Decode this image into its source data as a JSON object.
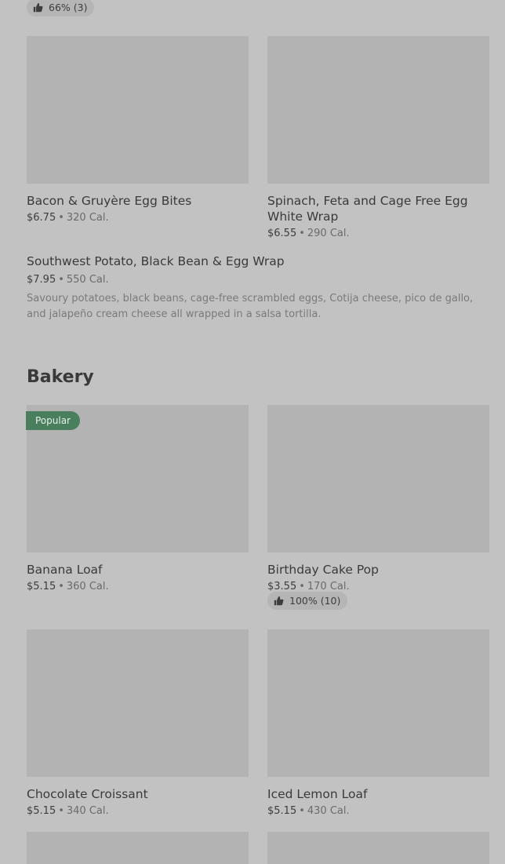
{
  "top_rating": {
    "text": "66% (3)",
    "icon": "thumbs-up-icon"
  },
  "breakfast": {
    "items": [
      {
        "name": "Bacon & Gruyère Egg Bites",
        "price": "$6.75",
        "separator": "•",
        "calories": "320 Cal."
      },
      {
        "name": "Spinach, Feta and Cage Free Egg",
        "name_line2": "White Wrap",
        "price": "$6.55",
        "separator": "•",
        "calories": "290 Cal."
      }
    ],
    "list_item": {
      "name": "Southwest Potato, Black Bean & Egg Wrap",
      "price": "$7.95",
      "separator": "•",
      "calories": "550 Cal.",
      "description": "Savoury potatoes, black beans, cage-free scrambled eggs, Cotija cheese, pico de gallo, and jalapeño cream cheese all wrapped in a salsa tortilla."
    }
  },
  "bakery": {
    "title": "Bakery",
    "popular_badge": "Popular",
    "items": [
      {
        "name": "Banana Loaf",
        "price": "$5.15",
        "separator": "•",
        "calories": "360 Cal."
      },
      {
        "name": "Birthday Cake Pop",
        "price": "$3.55",
        "separator": "•",
        "calories": "170 Cal.",
        "rating": "100% (10)"
      },
      {
        "name": "Chocolate Croissant",
        "price": "$5.15",
        "separator": "•",
        "calories": "340 Cal."
      },
      {
        "name": "Iced Lemon Loaf",
        "price": "$5.15",
        "separator": "•",
        "calories": "430 Cal."
      }
    ]
  },
  "colors": {
    "background": "#c2c2c2",
    "image_placeholder": "#b3b3b3",
    "popular_badge": "#4a7f5e",
    "rating_pill": "#b5b5b5"
  }
}
